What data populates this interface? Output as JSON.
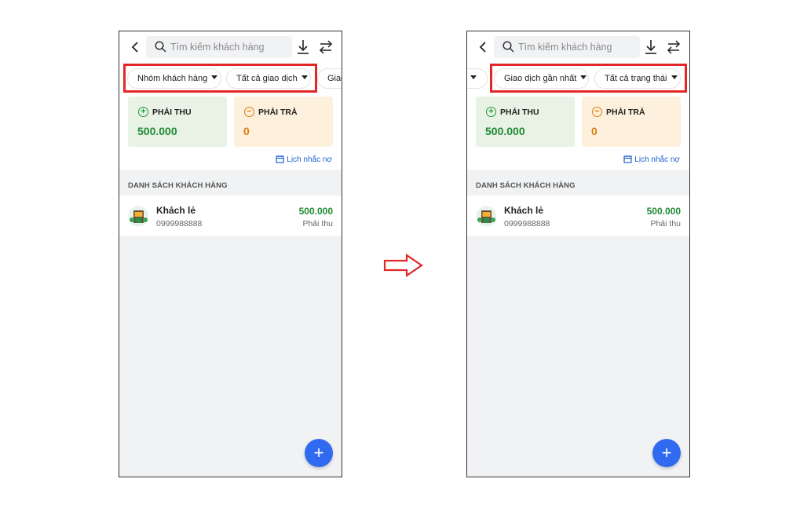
{
  "search": {
    "placeholder": "Tìm kiếm khách hàng"
  },
  "left_filters": [
    {
      "label": "Nhóm khách hàng"
    },
    {
      "label": "Tất cả giao dịch"
    },
    {
      "label": "Giao"
    }
  ],
  "right_filters": [
    {
      "label": "Giao dịch gần nhất"
    },
    {
      "label": "Tất cả trạng thái"
    }
  ],
  "summary": {
    "receivable": {
      "label": "PHẢI THU",
      "amount": "500.000"
    },
    "payable": {
      "label": "PHẢI TRẢ",
      "amount": "0"
    }
  },
  "reminder_label": "Lịch nhắc nợ",
  "section_title": "DANH SÁCH KHÁCH HÀNG",
  "customers": [
    {
      "name": "Khách lẻ",
      "phone": "0999988888",
      "amount": "500.000",
      "status": "Phải thu"
    }
  ],
  "fab_label": "+",
  "colors": {
    "highlight": "#e32626",
    "accent": "#2f6af0",
    "positive": "#1f8a34",
    "warning": "#e07b14"
  },
  "icons": [
    "back-icon",
    "search-icon",
    "download-icon",
    "swap-icon",
    "calendar-icon",
    "plus-circle-icon",
    "minus-circle-icon",
    "arrow-right-icon"
  ]
}
